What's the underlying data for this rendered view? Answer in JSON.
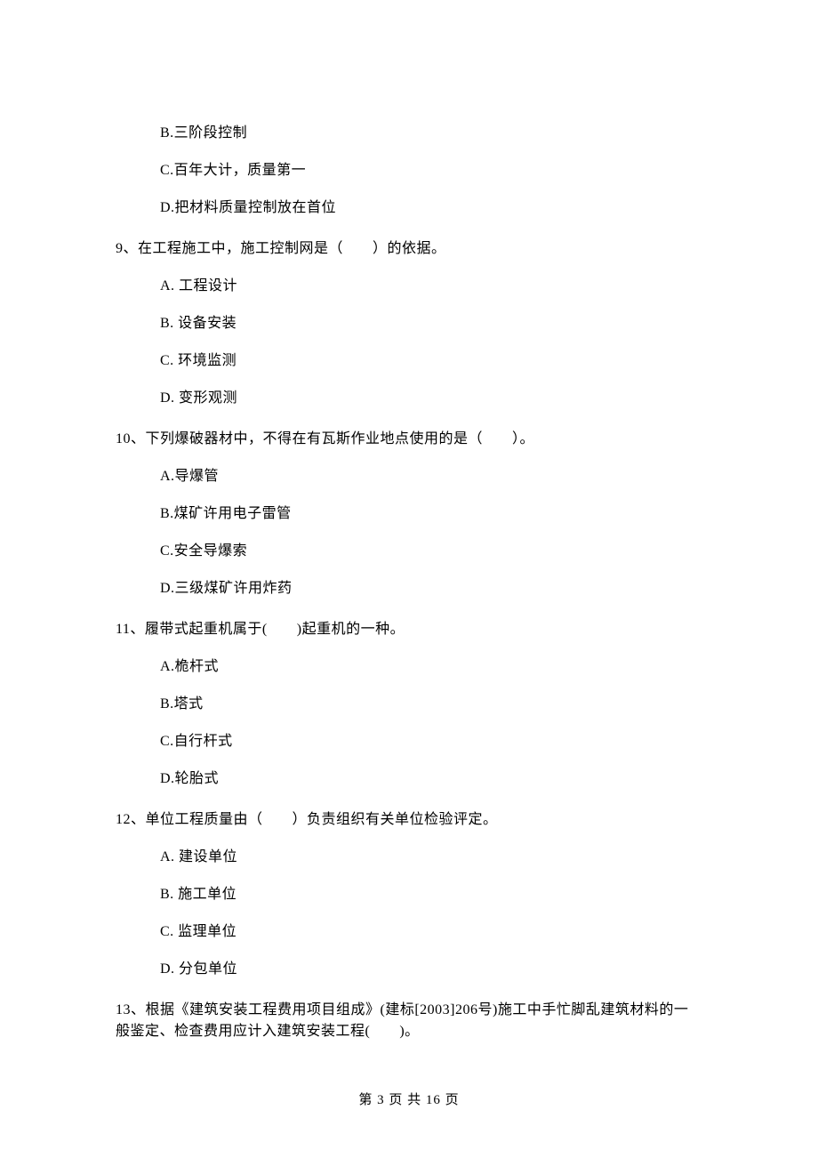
{
  "options_pre": [
    "B.三阶段控制",
    "C.百年大计，质量第一",
    "D.把材料质量控制放在首位"
  ],
  "questions": [
    {
      "stem": "9、在工程施工中，施工控制网是（　　）的依据。",
      "options": [
        "A.  工程设计",
        "B.  设备安装",
        "C.  环境监测",
        "D.  变形观测"
      ]
    },
    {
      "stem": "10、下列爆破器材中，不得在有瓦斯作业地点使用的是（　　）。",
      "options": [
        "A.导爆管",
        "B.煤矿许用电子雷管",
        "C.安全导爆索",
        "D.三级煤矿许用炸药"
      ]
    },
    {
      "stem": "11、履带式起重机属于(　　)起重机的一种。",
      "options": [
        "A.桅杆式",
        "B.塔式",
        "C.自行杆式",
        "D.轮胎式"
      ]
    },
    {
      "stem": "12、单位工程质量由（　　）负责组织有关单位检验评定。",
      "options": [
        "A.  建设单位",
        "B.  施工单位",
        "C.  监理单位",
        "D.  分包单位"
      ]
    },
    {
      "stem": "13、根据《建筑安装工程费用项目组成》(建标[2003]206号)施工中手忙脚乱建筑材料的一般鉴定、检查费用应计入建筑安装工程(　　)。",
      "options": []
    }
  ],
  "footer": "第 3 页 共 16 页"
}
